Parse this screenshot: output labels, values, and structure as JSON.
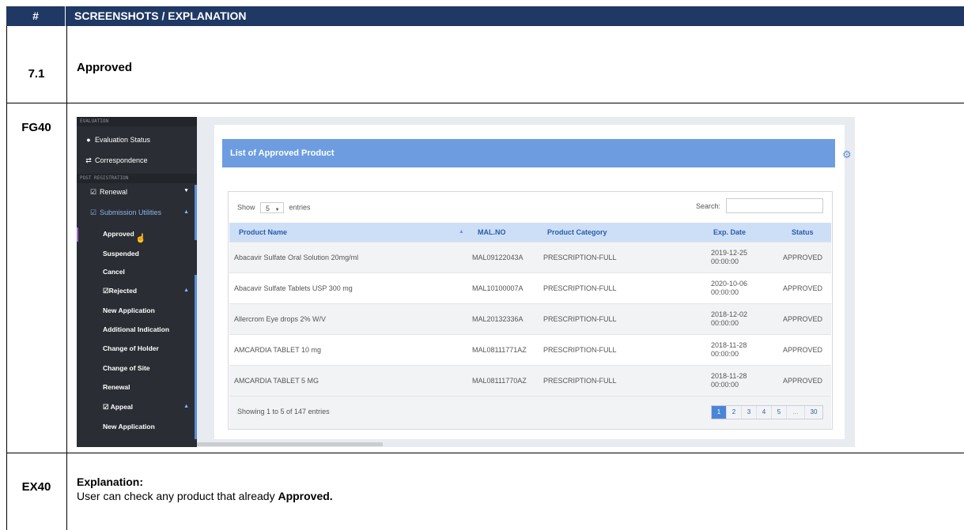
{
  "header": {
    "col1": "#",
    "col2": "SCREENSHOTS / EXPLANATION"
  },
  "row1": {
    "id": "7.1",
    "title": "Approved"
  },
  "row2": {
    "id": "FG40"
  },
  "row3": {
    "id": "EX40",
    "heading": "Explanation:",
    "text_prefix": "User can check any product that already ",
    "text_bold": "Approved."
  },
  "sidebar": {
    "section_evaluation": "EVALUATION",
    "evaluation_status": "Evaluation Status",
    "correspondence": "Correspondence",
    "section_post": "POST REGISTRATION",
    "renewal": "Renewal",
    "submission_utilities": "Submission Utilities",
    "approved": "Approved",
    "suspended": "Suspended",
    "cancel": "Cancel",
    "rejected": "Rejected",
    "new_application": "New Application",
    "additional_indication": "Additional Indication",
    "change_of_holder": "Change of Holder",
    "change_of_site": "Change of Site",
    "renewal_sub": "Renewal",
    "appeal": "Appeal",
    "new_application_2": "New Application"
  },
  "panel": {
    "title": "List of Approved Product",
    "show_label": "Show",
    "entries_value": "5",
    "entries_label": "entries",
    "search_label": "Search:",
    "search_value": "",
    "columns": [
      "Product Name",
      "MAL.NO",
      "Product Category",
      "Exp. Date",
      "Status"
    ],
    "rows": [
      {
        "name": "Abacavir Sulfate Oral Solution 20mg/ml",
        "mal": "MAL09122043A",
        "category": "PRESCRIPTION-FULL",
        "date": "2019-12-25",
        "time": "00:00:00",
        "status": "APPROVED"
      },
      {
        "name": "Abacavir Sulfate Tablets USP 300 mg",
        "mal": "MAL10100007A",
        "category": "PRESCRIPTION-FULL",
        "date": "2020-10-06",
        "time": "00:00:00",
        "status": "APPROVED"
      },
      {
        "name": "Allercrom Eye drops 2% W/V",
        "mal": "MAL20132336A",
        "category": "PRESCRIPTION-FULL",
        "date": "2018-12-02",
        "time": "00:00:00",
        "status": "APPROVED"
      },
      {
        "name": "AMCARDIA TABLET 10 mg",
        "mal": "MAL08111771AZ",
        "category": "PRESCRIPTION-FULL",
        "date": "2018-11-28",
        "time": "00:00:00",
        "status": "APPROVED"
      },
      {
        "name": "AMCARDIA TABLET 5 MG",
        "mal": "MAL08111770AZ",
        "category": "PRESCRIPTION-FULL",
        "date": "2018-11-28",
        "time": "00:00:00",
        "status": "APPROVED"
      }
    ],
    "footer_info": "Showing 1 to 5 of 147 entries",
    "pages": [
      "1",
      "2",
      "3",
      "4",
      "5",
      "...",
      "30"
    ]
  },
  "colors": {
    "header_bg": "#1f3864",
    "panel_title_bg": "#6d9de0",
    "sidebar_bg": "#2a2d33",
    "table_header_bg": "#cddff7"
  }
}
